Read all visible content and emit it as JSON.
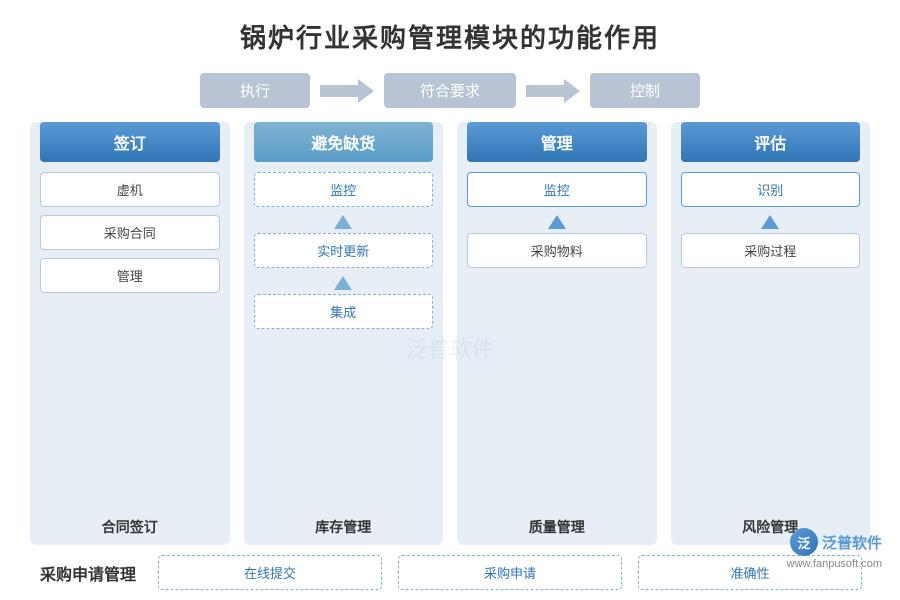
{
  "title": "锅炉行业采购管理模块的功能作用",
  "flow": {
    "items": [
      "执行",
      "符合要求",
      "控制"
    ],
    "arrow": "→"
  },
  "columns": [
    {
      "id": "col1",
      "header": "签订",
      "header_style": "blue",
      "items": [
        {
          "label": "虚机",
          "style": "solid"
        },
        {
          "label": "采购合同",
          "style": "solid"
        },
        {
          "label": "管理",
          "style": "solid"
        }
      ],
      "footer": "合同签订"
    },
    {
      "id": "col2",
      "header": "避免缺货",
      "header_style": "light-blue",
      "items": [
        {
          "label": "监控",
          "style": "dashed"
        },
        {
          "label": "实时更新",
          "style": "dashed"
        },
        {
          "label": "集成",
          "style": "dashed"
        }
      ],
      "footer": "库存管理"
    },
    {
      "id": "col3",
      "header": "管理",
      "header_style": "blue",
      "items": [
        {
          "label": "监控",
          "style": "solid"
        },
        {
          "label": "采购物料",
          "style": "solid"
        }
      ],
      "footer": "质量管理"
    },
    {
      "id": "col4",
      "header": "评估",
      "header_style": "blue",
      "items": [
        {
          "label": "识别",
          "style": "solid"
        },
        {
          "label": "采购过程",
          "style": "solid"
        }
      ],
      "footer": "风险管理"
    }
  ],
  "bottom": {
    "label": "采购申请管理",
    "items": [
      "在线提交",
      "采购申请",
      "准确性"
    ]
  },
  "watermark": {
    "logo_text": "泛",
    "brand": "泛普软件",
    "url": "www.fanpusoft.com"
  },
  "center_watermark": "泛普软件"
}
